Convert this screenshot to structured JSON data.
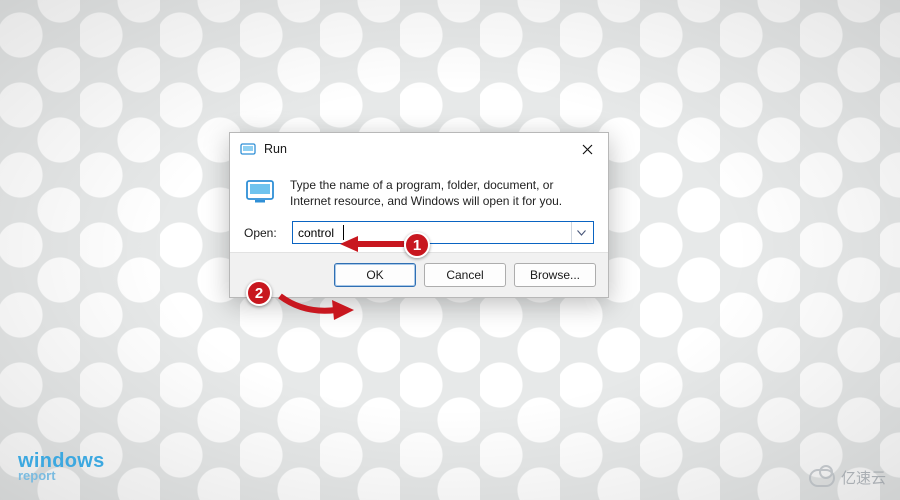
{
  "dialog": {
    "title": "Run",
    "description": "Type the name of a program, folder, document, or Internet resource, and Windows will open it for you.",
    "open_label": "Open:",
    "input_value": "control",
    "buttons": {
      "ok": "OK",
      "cancel": "Cancel",
      "browse": "Browse..."
    }
  },
  "annotations": {
    "step1": "1",
    "step2": "2"
  },
  "watermarks": {
    "left_line1": "windows",
    "left_line2": "report",
    "right": "亿速云"
  }
}
